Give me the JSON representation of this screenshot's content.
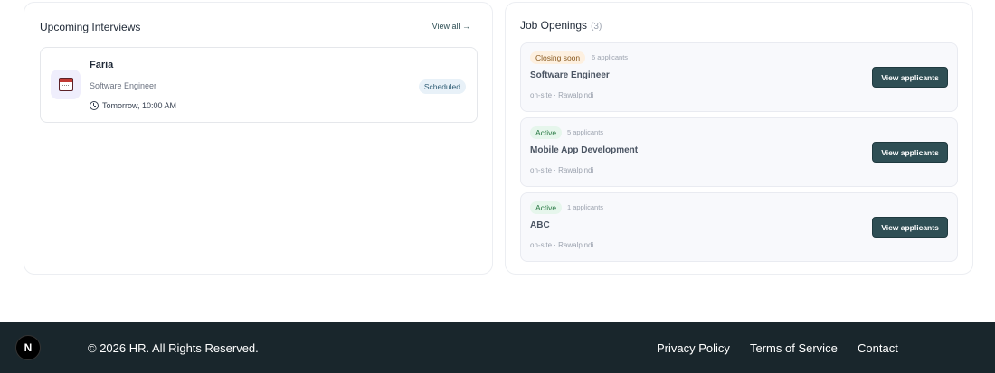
{
  "interviews": {
    "title": "Upcoming Interviews",
    "view_all": "View all →",
    "items": [
      {
        "name": "Faria",
        "role": "Software Engineer",
        "time": "Tomorrow, 10:00 AM",
        "status": "Scheduled"
      }
    ]
  },
  "jobs": {
    "title": "Job Openings",
    "count": "(3)",
    "button_label": "View applicants",
    "items": [
      {
        "status": "Closing soon",
        "applicants": "6 applicants",
        "title": "Software Engineer",
        "location": "on-site · Rawalpindi"
      },
      {
        "status": "Active",
        "applicants": "5 applicants",
        "title": "Mobile App Development",
        "location": "on-site · Rawalpindi"
      },
      {
        "status": "Active",
        "applicants": "1 applicants",
        "title": "ABC",
        "location": "on-site · Rawalpindi"
      }
    ]
  },
  "footer": {
    "logo_letter": "N",
    "copyright": "© 2026 HR. All Rights Reserved.",
    "links": [
      "Privacy Policy",
      "Terms of Service",
      "Contact"
    ]
  }
}
